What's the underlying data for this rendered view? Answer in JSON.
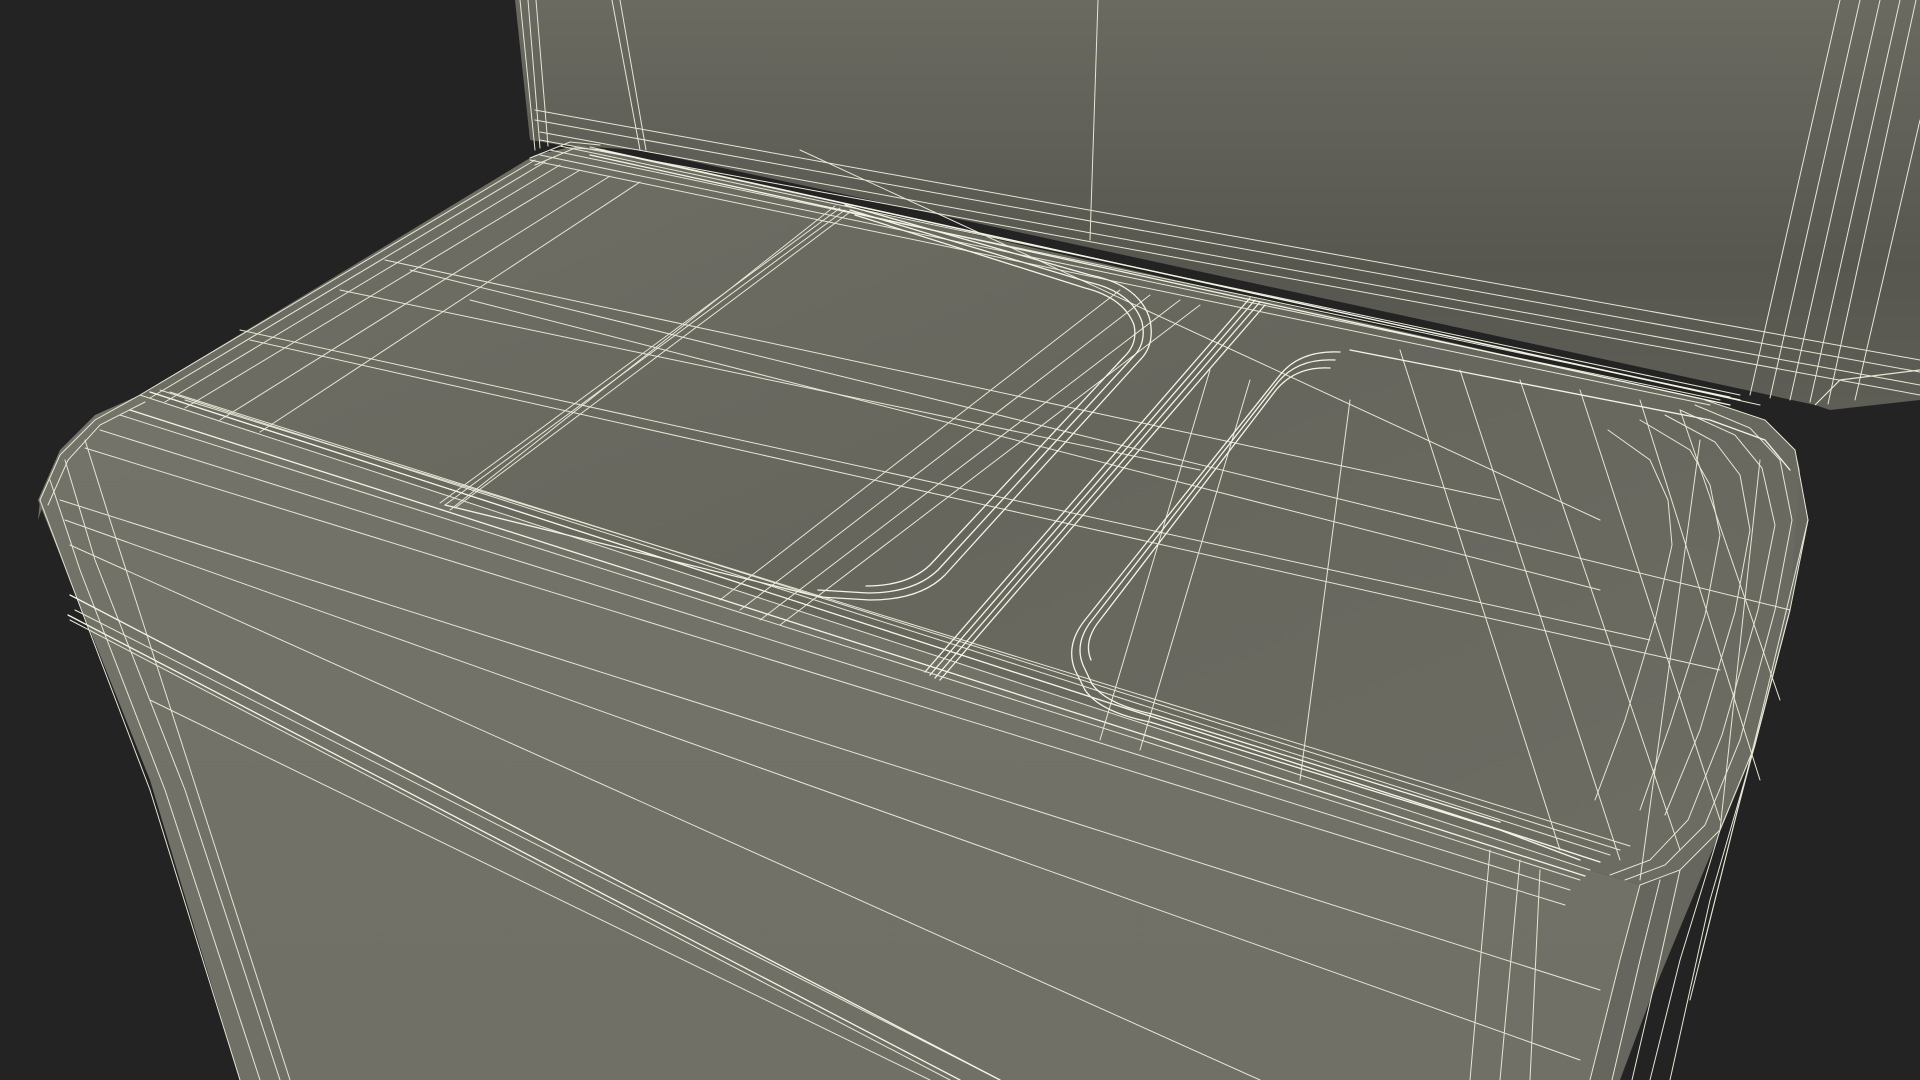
{
  "scene": {
    "subject": "wireframe-seat-cushion-with-backrest",
    "background_color": "#232323",
    "surface_color": "#6c6c62",
    "surface_shadow_color": "#56564f",
    "wire_color": "#e6e6d4",
    "wire_edge_color": "#f4f4e6"
  }
}
